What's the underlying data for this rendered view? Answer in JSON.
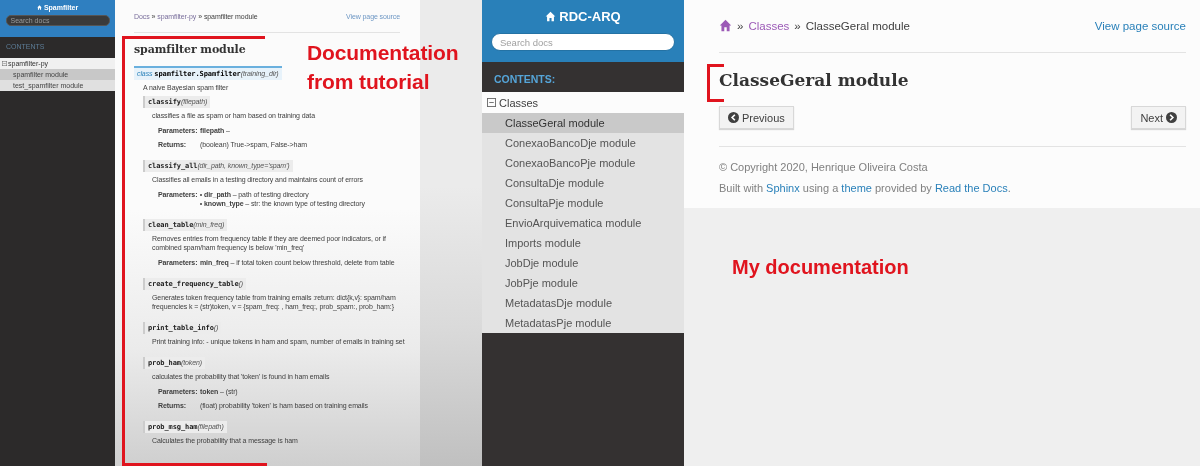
{
  "tutorial": {
    "sidebar": {
      "title": "Spamfilter",
      "search_placeholder": "Search docs",
      "caption": "CONTENTS",
      "items": [
        {
          "label": "spamfilter-py",
          "expanded": true,
          "selected": false,
          "children": [
            {
              "label": "spamfilter module",
              "selected": true
            },
            {
              "label": "test_spamfilter module",
              "selected": false
            }
          ]
        }
      ]
    },
    "breadcrumbs": [
      {
        "kind": "link",
        "text": "Docs"
      },
      {
        "kind": "sep",
        "text": "»"
      },
      {
        "kind": "link",
        "text": "spamfilter-py"
      },
      {
        "kind": "sep",
        "text": "»"
      },
      {
        "kind": "current",
        "text": "spamfilter module"
      }
    ],
    "view_source": "View page source",
    "title": "spamfilter module",
    "class_signature": {
      "keyword": "class",
      "name": "spamfilter.Spamfilter",
      "params": "(training_dir)"
    },
    "class_description": "A naive Bayesian spam filter",
    "methods": [
      {
        "name": "classify",
        "params": "(filepath)",
        "description": "classifies a file as spam or ham based on training data",
        "fields": [
          {
            "label": "Parameters:",
            "kind": "text",
            "value": "**filepath** –"
          },
          {
            "label": "Returns:",
            "kind": "text",
            "value": "(boolean) True->spam, False->ham"
          }
        ]
      },
      {
        "name": "classify_all",
        "params": "(dir_path, known_type='spam')",
        "description": "Classifies all emails in a testing directory and maintains count of errors",
        "fields": [
          {
            "label": "Parameters:",
            "kind": "list",
            "items": [
              "**dir_path** – path of testing directory",
              "**known_type** – str: the known type of testing directory"
            ]
          }
        ]
      },
      {
        "name": "clean_table",
        "params": "(min_freq)",
        "description": "Removes entries from frequency table if they are deemed poor indicators, or if combined spam/ham frequency is below 'min_freq'",
        "fields": [
          {
            "label": "Parameters:",
            "kind": "text",
            "value": "**min_freq** – if total token count below threshold, delete from table"
          }
        ]
      },
      {
        "name": "create_frequency_table",
        "params": "()",
        "description": "Generates token frequency table from training emails :return: dict{k,v}: spam/ham frequencies k = (str)token, v = {spam_freq: , ham_freq:, prob_spam:, prob_ham:}"
      },
      {
        "name": "print_table_info",
        "params": "()",
        "description": "Print training info: - unique tokens in ham and spam, number of emails in training set"
      },
      {
        "name": "prob_ham",
        "params": "(token)",
        "description": "calculates the probability that 'token' is found in ham emails",
        "fields": [
          {
            "label": "Parameters:",
            "kind": "text",
            "value": "**token** – (str)"
          },
          {
            "label": "Returns:",
            "kind": "text",
            "value": "(float) probability 'token' is ham based on training emails"
          }
        ]
      },
      {
        "name": "prob_msg_ham",
        "params": "(filepath)",
        "description": "Calculates the probability that a message is ham"
      }
    ],
    "annotation": "Documentation from tutorial"
  },
  "mine": {
    "sidebar": {
      "title": "RDC-ARQ",
      "search_placeholder": "Search docs",
      "caption": "CONTENTS:",
      "items": [
        {
          "label": "Classes",
          "expanded": true,
          "selected": false,
          "children": [
            {
              "label": "ClasseGeral module",
              "selected": true
            },
            {
              "label": "ConexaoBancoDje module",
              "selected": false
            },
            {
              "label": "ConexaoBancoPje module",
              "selected": false
            },
            {
              "label": "ConsultaDje module",
              "selected": false
            },
            {
              "label": "ConsultaPje module",
              "selected": false
            },
            {
              "label": "EnvioArquivematica module",
              "selected": false
            },
            {
              "label": "Imports module",
              "selected": false
            },
            {
              "label": "JobDje module",
              "selected": false
            },
            {
              "label": "JobPje module",
              "selected": false
            },
            {
              "label": "MetadatasDje module",
              "selected": false
            },
            {
              "label": "MetadatasPje module",
              "selected": false
            }
          ]
        }
      ]
    },
    "breadcrumbs": [
      {
        "kind": "home"
      },
      {
        "kind": "sep",
        "text": "»"
      },
      {
        "kind": "link",
        "text": "Classes"
      },
      {
        "kind": "sep",
        "text": "»"
      },
      {
        "kind": "current",
        "text": "ClasseGeral module"
      }
    ],
    "view_source": "View page source",
    "title": "ClasseGeral module",
    "previous": "Previous",
    "next": "Next",
    "copyright": "© Copyright 2020, Henrique Oliveira Costa",
    "built_with": [
      {
        "kind": "text",
        "text": "Built with"
      },
      {
        "kind": "link",
        "text": "Sphinx"
      },
      {
        "kind": "text",
        "text": "using a"
      },
      {
        "kind": "link",
        "text": "theme"
      },
      {
        "kind": "text",
        "text": "provided by"
      },
      {
        "kind": "link",
        "text": "Read the Docs"
      },
      {
        "kind": "text",
        "text": "."
      }
    ],
    "annotation": "My documentation"
  }
}
